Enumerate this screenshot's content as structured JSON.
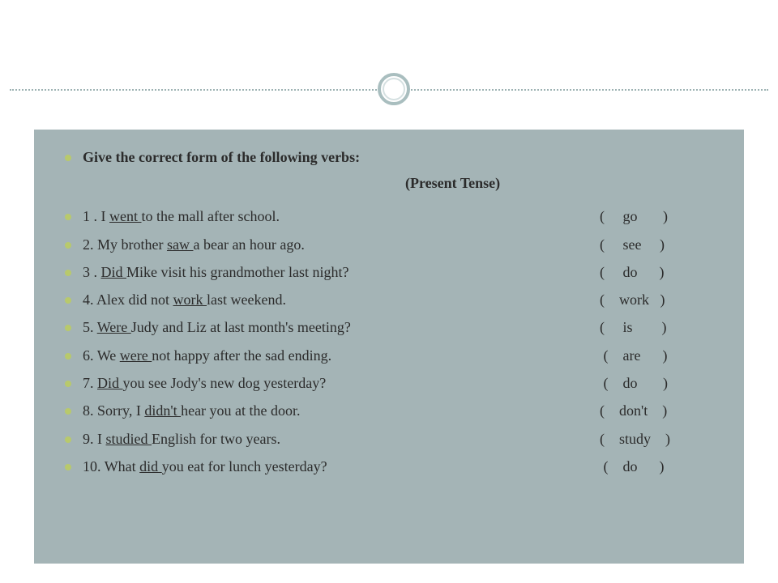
{
  "title": "Give the correct form of the following verbs:",
  "subtitle": "(Present Tense)",
  "items": [
    {
      "num": "1 .",
      "pre": "I ",
      "ans": " went     ",
      "post": "  to the mall after school.",
      "hint": "(     go       )"
    },
    {
      "num": "2.",
      "pre": "My brother ",
      "ans": " saw      ",
      "post": " a bear an hour ago.",
      "hint": "(     see     )"
    },
    {
      "num": "3 .",
      "pre": "",
      "ans": "   Did  ",
      "post": " Mike visit his grandmother last night?",
      "hint": "(     do      )"
    },
    {
      "num": "4.",
      "pre": " Alex did not ",
      "ans": " work   ",
      "post": " last weekend.",
      "hint": "(    work   )"
    },
    {
      "num": "5.",
      "pre": "",
      "ans": " Were  ",
      "post": " Judy and Liz at last month's meeting?",
      "hint": "(     is        )"
    },
    {
      "num": "6.",
      "pre": "We ",
      "ans": " were  ",
      "post": " not happy after the sad ending.",
      "hint": " (    are      )"
    },
    {
      "num": "7.",
      "pre": "",
      "ans": " Did  ",
      "post": " you see Jody's new dog yesterday?",
      "hint": " (    do       )"
    },
    {
      "num": "8.",
      "pre": " Sorry, I ",
      "ans": " didn't     ",
      "post": "  hear  you at the door.",
      "hint": "(    don't    )"
    },
    {
      "num": "9.",
      "pre": "I ",
      "ans": " studied      ",
      "post": "  English for two years.",
      "hint": "(    study    )"
    },
    {
      "num": "10.",
      "pre": "What ",
      "ans": "   did    ",
      "post": " you eat for lunch yesterday?",
      "hint": " (    do      )"
    }
  ]
}
